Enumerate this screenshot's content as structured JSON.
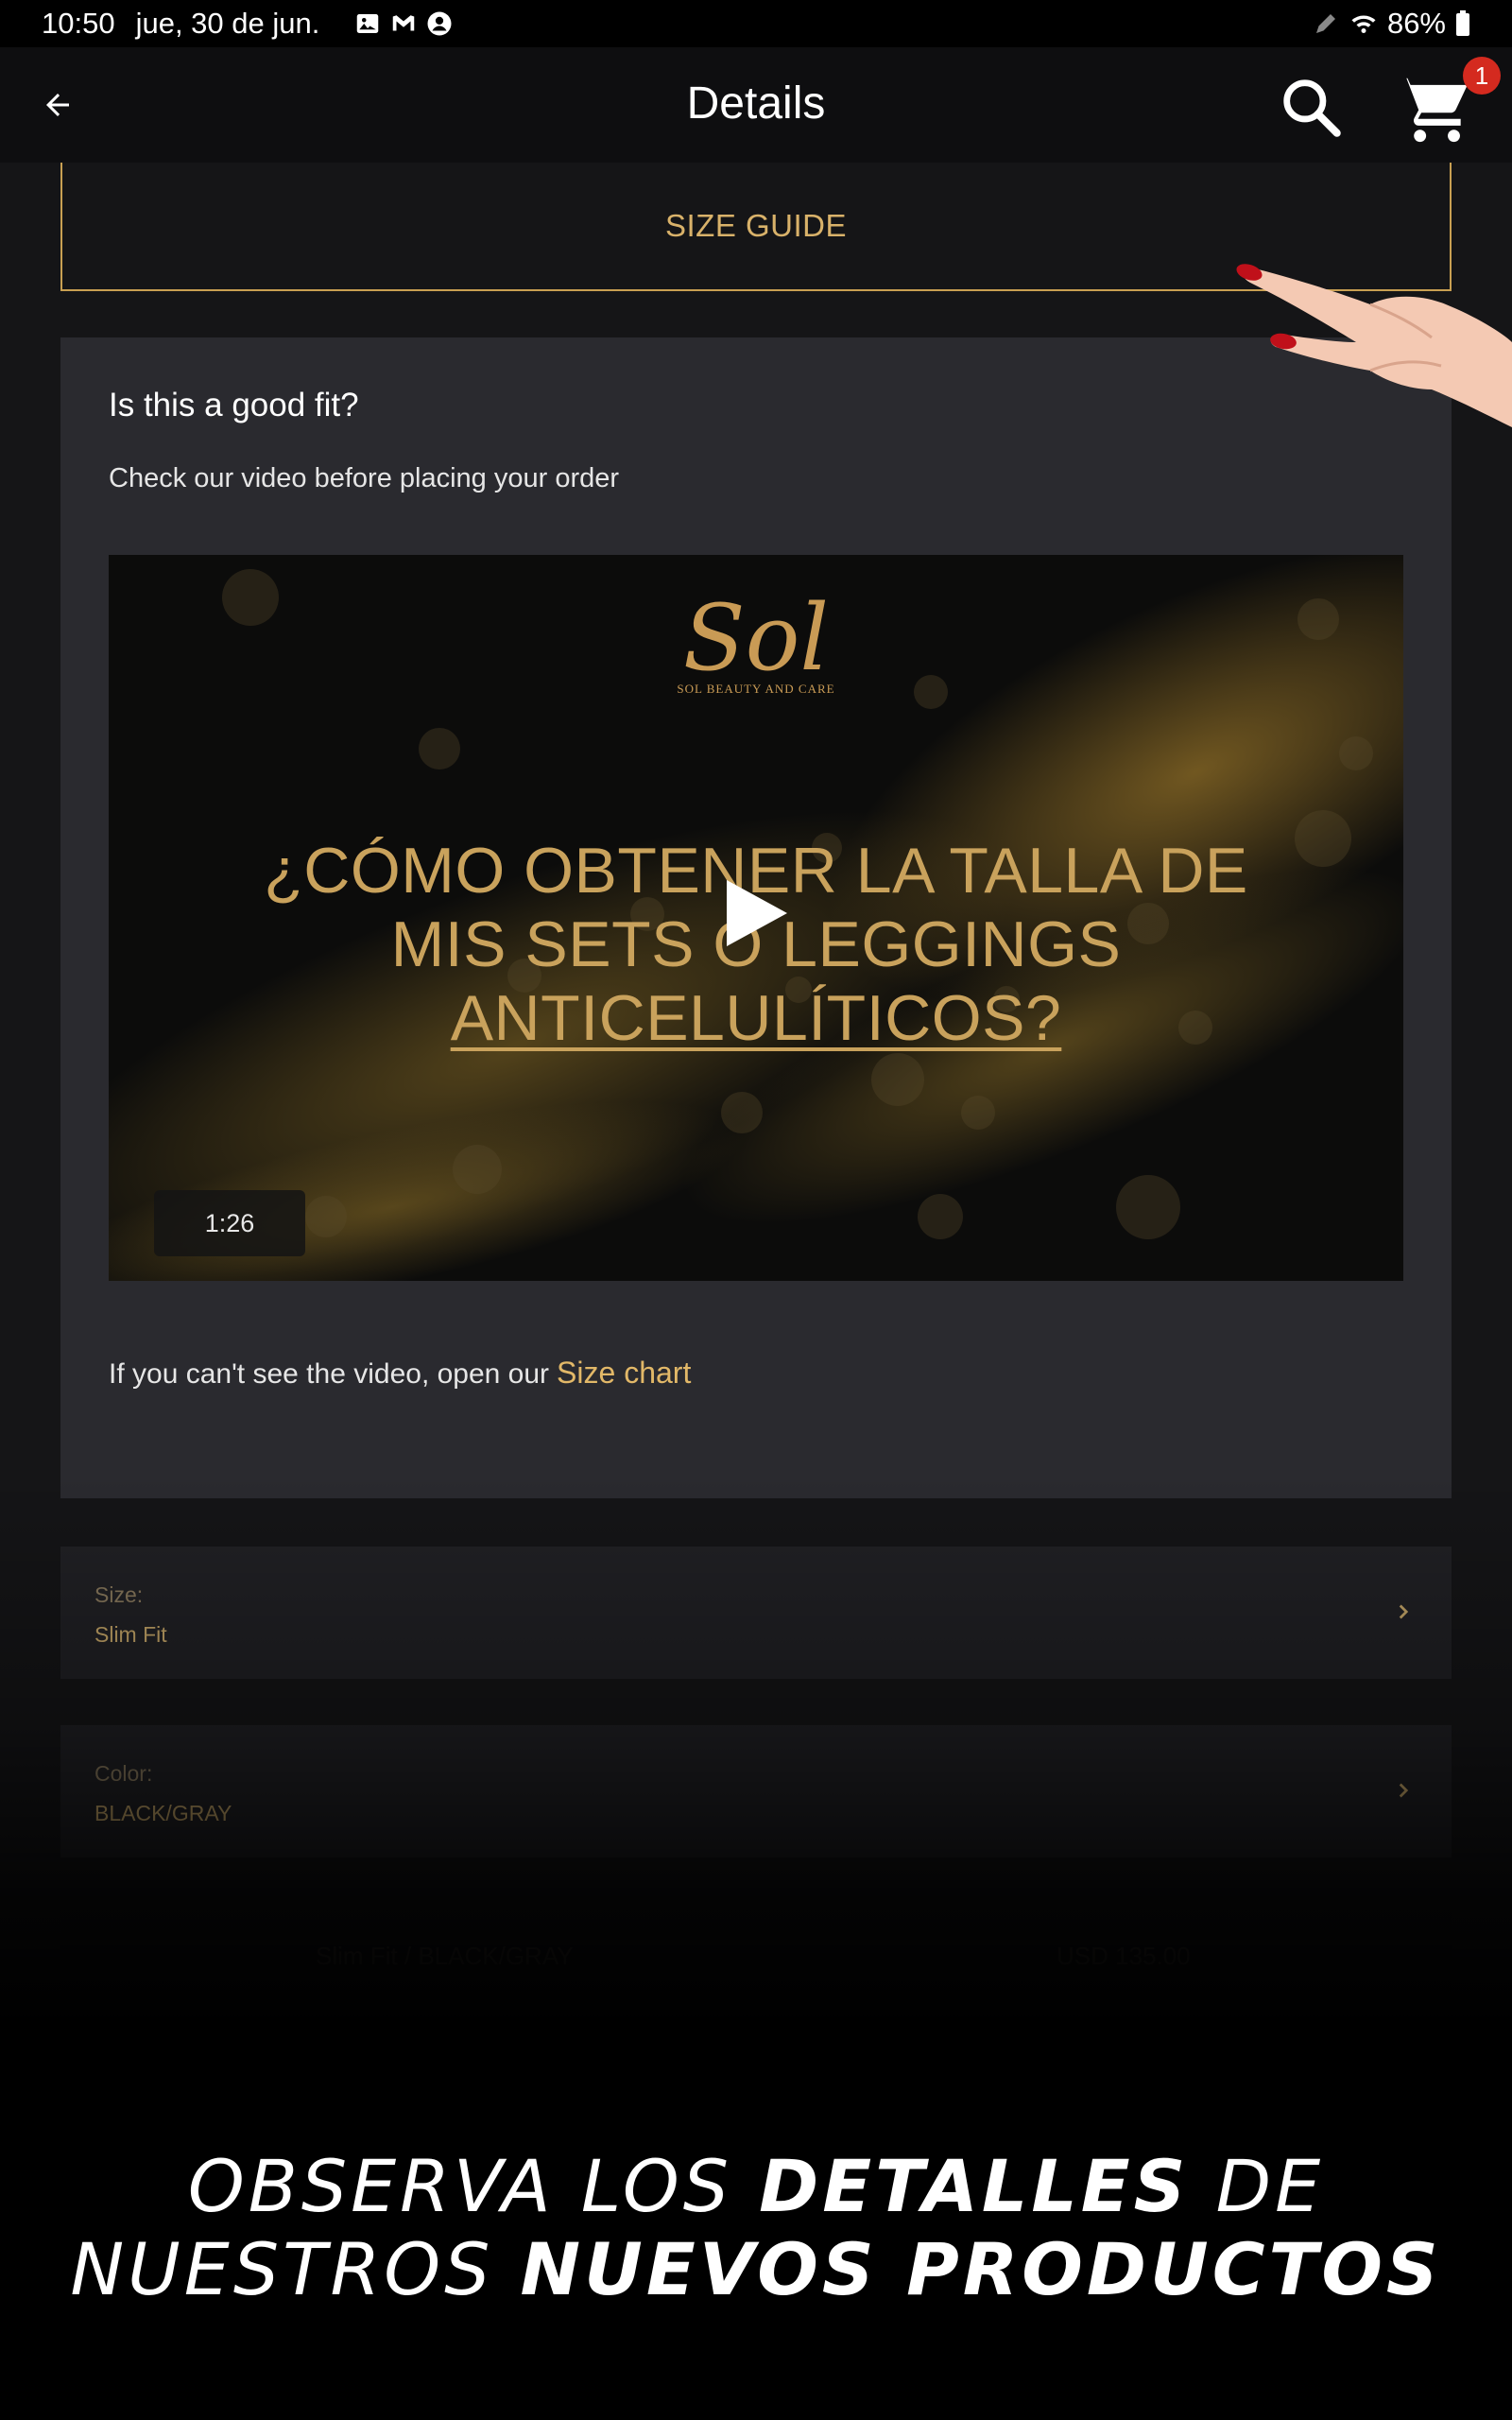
{
  "status_bar": {
    "time": "10:50",
    "date": "jue, 30 de jun.",
    "battery": "86%",
    "icons": [
      "gallery-icon",
      "gmail-icon",
      "account-icon",
      "pen-icon",
      "wifi-icon",
      "battery-icon"
    ]
  },
  "app_bar": {
    "title": "Details",
    "cart_count": "1",
    "icons": [
      "back-arrow-icon",
      "search-icon",
      "cart-icon"
    ]
  },
  "size_guide": {
    "label": "SIZE GUIDE"
  },
  "fit_card": {
    "title": "Is this a good fit?",
    "subtitle": "Check our video before placing your order",
    "video": {
      "logo_text": "Sol",
      "logo_subtext": "SOL BEAUTY AND CARE",
      "headline_line1": "¿CÓMO OBTENER LA TALLA DE",
      "headline_line2": "MIS SETS O LEGGINGS",
      "headline_line3": "ANTICELULÍTICOS?",
      "duration": "1:26"
    },
    "footer_text": "If you can't see the video, open our",
    "footer_link": "Size chart"
  },
  "options": [
    {
      "label": "Size:",
      "value": "Slim Fit"
    },
    {
      "label": "Color:",
      "value": "BLACK/GRAY"
    }
  ],
  "variant": {
    "name": "Slim Fit / BLACK/GRAY",
    "price": "USD 135.00"
  },
  "promo": {
    "line1_light": "OBSERVA LOS",
    "line1_bold": "DETALLES",
    "line1_light2": "DE",
    "line2_light": "NUESTROS",
    "line2_bold": "NUEVOS PRODUCTOS"
  },
  "colors": {
    "background": "#151517",
    "card": "#2a2a2f",
    "accent_gold": "#c9a052",
    "link_gold": "#e2b868",
    "badge_red": "#d42a1f"
  }
}
